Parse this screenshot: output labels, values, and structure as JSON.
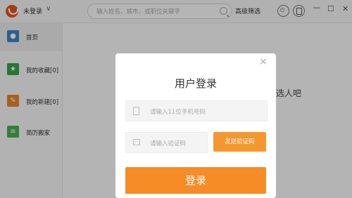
{
  "titlebar": {
    "user_label": "未登录",
    "user_chevron": "∨",
    "search_placeholder": "输入姓名、城市、或职位关键字",
    "advanced_filter": "高级筛选",
    "window_controls": {
      "minimize": "—",
      "maximize": "☐",
      "close": "✕"
    }
  },
  "sidebar": {
    "items": [
      {
        "label": "首页",
        "icon": "person-icon",
        "color": "#3a86c8",
        "glyph": "👤"
      },
      {
        "label": "我的收藏[0]",
        "icon": "star-icon",
        "color": "#35a34a",
        "glyph": "★"
      },
      {
        "label": "我的新建[0]",
        "icon": "pencil-icon",
        "color": "#e8862a",
        "glyph": "✎"
      },
      {
        "label": "简历搬家",
        "icon": "document-icon",
        "color": "#4caf50",
        "glyph": "▤"
      }
    ]
  },
  "content": {
    "hint_fragment": "选人吧"
  },
  "login_modal": {
    "title": "用户登录",
    "close": "×",
    "phone_placeholder": "请输入11位手机号码",
    "code_placeholder": "请输入验证码",
    "send_code_label": "发送验证码",
    "login_label": "登录",
    "accent_color": "#f58c26"
  }
}
